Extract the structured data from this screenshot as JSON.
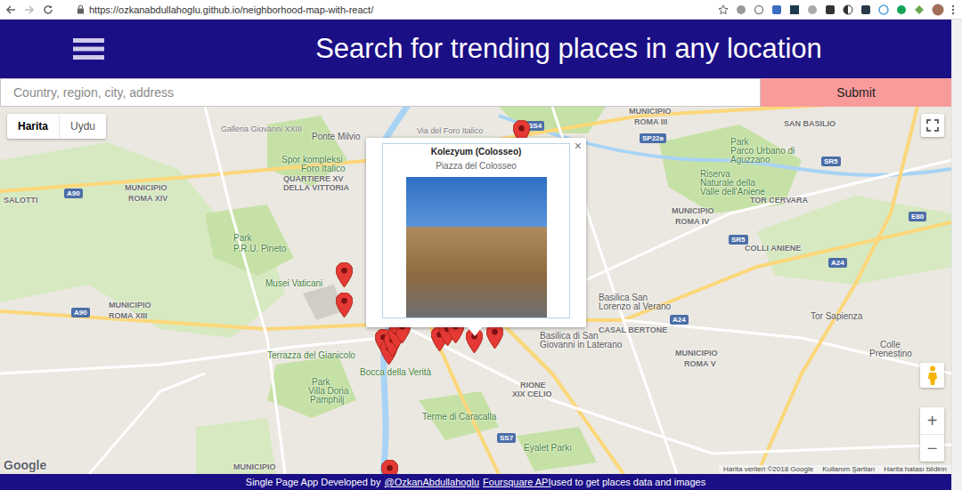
{
  "browser": {
    "url": "https://ozkanabdullahoglu.github.io/neighborhood-map-with-react/"
  },
  "header": {
    "title": "Search for trending places in any location"
  },
  "search": {
    "placeholder": "Country, region, city, address",
    "button": "Submit"
  },
  "map": {
    "type_tabs": [
      {
        "label": "Harita",
        "selected": true
      },
      {
        "label": "Uydu",
        "selected": false
      }
    ],
    "labels": [
      {
        "text": "Ponte Milvio",
        "kind": "place"
      },
      {
        "text": "Via del Foro Italico",
        "kind": "road"
      },
      {
        "text": "Spor kompleksi",
        "kind": "park"
      },
      {
        "text": "Foro Italico",
        "kind": "park"
      },
      {
        "text": "QUARTIERE XV",
        "kind": "district"
      },
      {
        "text": "DELLA VITTORIA",
        "kind": "district"
      },
      {
        "text": "MUNICIPIO",
        "kind": "district"
      },
      {
        "text": "ROMA XIV",
        "kind": "district"
      },
      {
        "text": "SALOTTI",
        "kind": "district"
      },
      {
        "text": "Park",
        "kind": "park"
      },
      {
        "text": "P.R.U. Pineto",
        "kind": "park"
      },
      {
        "text": "Musei Vaticani",
        "kind": "park"
      },
      {
        "text": "MUNICIPIO",
        "kind": "district"
      },
      {
        "text": "ROMA XIII",
        "kind": "district"
      },
      {
        "text": "Terrazza del Gianicolo",
        "kind": "park"
      },
      {
        "text": "Bocca della Verità",
        "kind": "park"
      },
      {
        "text": "Park",
        "kind": "park"
      },
      {
        "text": "Villa Doria",
        "kind": "park"
      },
      {
        "text": "Pamphilj",
        "kind": "park"
      },
      {
        "text": "Terme di Caracalla",
        "kind": "park"
      },
      {
        "text": "RIONE",
        "kind": "district"
      },
      {
        "text": "XIX CELIO",
        "kind": "district"
      },
      {
        "text": "Basilica di San",
        "kind": "place"
      },
      {
        "text": "Giovanni in Laterano",
        "kind": "place"
      },
      {
        "text": "Basilica San",
        "kind": "place"
      },
      {
        "text": "Lorenzo al Verano",
        "kind": "place"
      },
      {
        "text": "CASAL BERTONE",
        "kind": "district"
      },
      {
        "text": "MUNICIPIO",
        "kind": "district"
      },
      {
        "text": "ROMA V",
        "kind": "district"
      },
      {
        "text": "Eyalet Parkı",
        "kind": "park"
      },
      {
        "text": "MUNICIPIO",
        "kind": "district"
      },
      {
        "text": "ROMA III",
        "kind": "district"
      },
      {
        "text": "SAN BASILIO",
        "kind": "district"
      },
      {
        "text": "Park",
        "kind": "park"
      },
      {
        "text": "Parco Urbano di",
        "kind": "park"
      },
      {
        "text": "Aguzzano",
        "kind": "park"
      },
      {
        "text": "Riserva",
        "kind": "park"
      },
      {
        "text": "Naturale della",
        "kind": "park"
      },
      {
        "text": "Valle dell'Aniene",
        "kind": "park"
      },
      {
        "text": "TOR CERVARA",
        "kind": "district"
      },
      {
        "text": "MUNICIPIO",
        "kind": "district"
      },
      {
        "text": "ROMA IV",
        "kind": "district"
      },
      {
        "text": "COLLI ANIENE",
        "kind": "district"
      },
      {
        "text": "Tor Sapienza",
        "kind": "place"
      },
      {
        "text": "Colle",
        "kind": "place"
      },
      {
        "text": "Prenestino",
        "kind": "place"
      },
      {
        "text": "MUNICIPIO",
        "kind": "district"
      },
      {
        "text": "Galleria Giovanni XXIII",
        "kind": "road"
      }
    ],
    "road_shields": [
      "A90",
      "A90",
      "SS4",
      "SP22a",
      "SR5",
      "SR5",
      "A24",
      "E80",
      "A24",
      "SS7"
    ],
    "info_window": {
      "title": "Kolezyum (Colosseo)",
      "address": "Piazza del Colosseo",
      "close": "×"
    },
    "zoom_in": "+",
    "zoom_out": "−",
    "logo": "Google",
    "attribution": [
      "Harita verileri ©2018 Google",
      "Kullanım Şartları",
      "Harita hatası bildirin"
    ]
  },
  "footer": {
    "prefix": "Single Page App Developed by",
    "author": "@OzkanAbdullahoglu",
    "api": "Foursquare API",
    "suffix": "used to get places data and images"
  }
}
